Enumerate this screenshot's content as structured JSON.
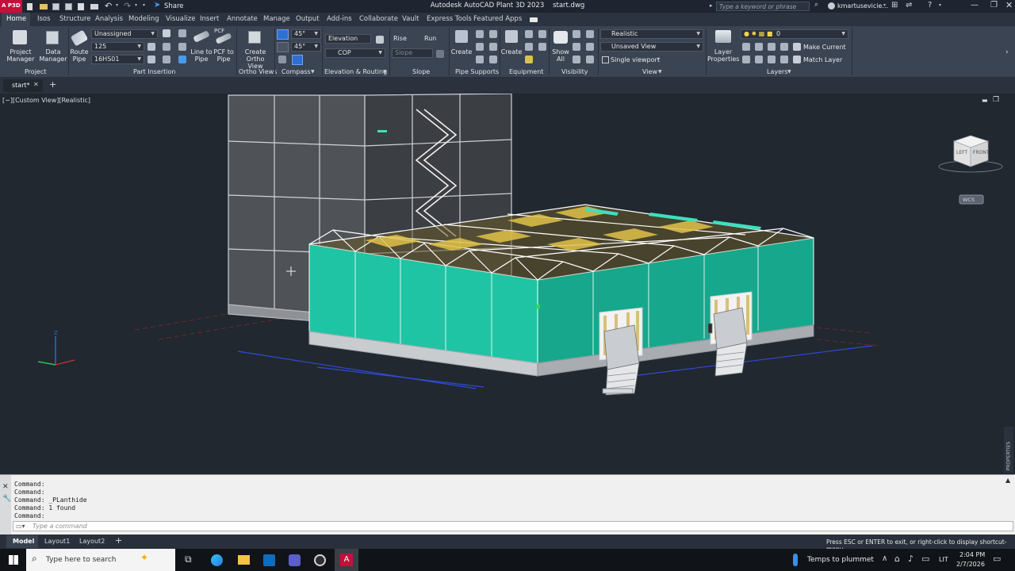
{
  "titlebar": {
    "app_badge": "A P3D",
    "share_label": "Share",
    "title_app": "Autodesk AutoCAD Plant 3D 2023",
    "title_file": "start.dwg",
    "search_placeholder": "Type a keyword or phrase",
    "user": "kmartusevicie..."
  },
  "menu": [
    "Home",
    "Isos",
    "Structure",
    "Analysis",
    "Modeling",
    "Visualize",
    "Insert",
    "Annotate",
    "Manage",
    "Output",
    "Add-ins",
    "Collaborate",
    "Vault",
    "Express Tools",
    "Featured Apps"
  ],
  "ribbon": {
    "project_manager": "Project Manager",
    "data_manager": "Data Manager",
    "route_pipe": "Route Pipe",
    "spec": "Unassigned",
    "size": "125",
    "line_number": "16HS01",
    "line_to_pipe": "Line to Pipe",
    "pcf_to_pipe": "PCF to Pipe",
    "pcf_badge": "PCF",
    "create_ortho": "Create Ortho View",
    "angle1": "45°",
    "angle2": "45°",
    "elevation": "Elevation",
    "cop": "COP",
    "rise": "Rise",
    "run": "Run",
    "slope": "Slope",
    "create_support": "Create",
    "create_equipment": "Create",
    "show_all": "Show All",
    "visual_style": "Realistic",
    "view_name": "Unsaved View",
    "viewport_config": "Single viewport",
    "layer_properties": "Layer Properties",
    "layer_name": "0",
    "make_current": "Make Current",
    "match_layer": "Match Layer",
    "panels": {
      "project": "Project",
      "part_insertion": "Part Insertion",
      "ortho_views": "Ortho Views",
      "compass": "Compass",
      "elevation_routing": "Elevation & Routing",
      "slope": "Slope",
      "pipe_supports": "Pipe Supports",
      "equipment": "Equipment",
      "visibility": "Visibility",
      "view": "View",
      "layers": "Layers"
    }
  },
  "doc_tab": "start*",
  "viewport": {
    "label": "[−][Custom View][Realistic]",
    "viewcube_left": "LEFT",
    "viewcube_front": "FRONT",
    "wcs": "WCS",
    "properties": "PROPERTIES"
  },
  "command": {
    "history": [
      "Command:",
      "Command:",
      "Command: _PLanthide",
      "Command: 1 found",
      "Command:"
    ],
    "placeholder": "Type a command"
  },
  "layout_tabs": [
    "Model",
    "Layout1",
    "Layout2"
  ],
  "status_text": "Press ESC or ENTER to exit, or right-click to display shortcut-menu.",
  "taskbar": {
    "search_placeholder": "Type here to search",
    "weather": "Temps to plummet",
    "lang": "LIT",
    "time": "2:04 PM",
    "date": "2/7/2026"
  },
  "colors": {
    "teal_wall": "#1fc4a4",
    "ribbon_bg": "#3b4453",
    "viewport_bg": "#212830",
    "accent_blue": "#2f6fd1"
  }
}
